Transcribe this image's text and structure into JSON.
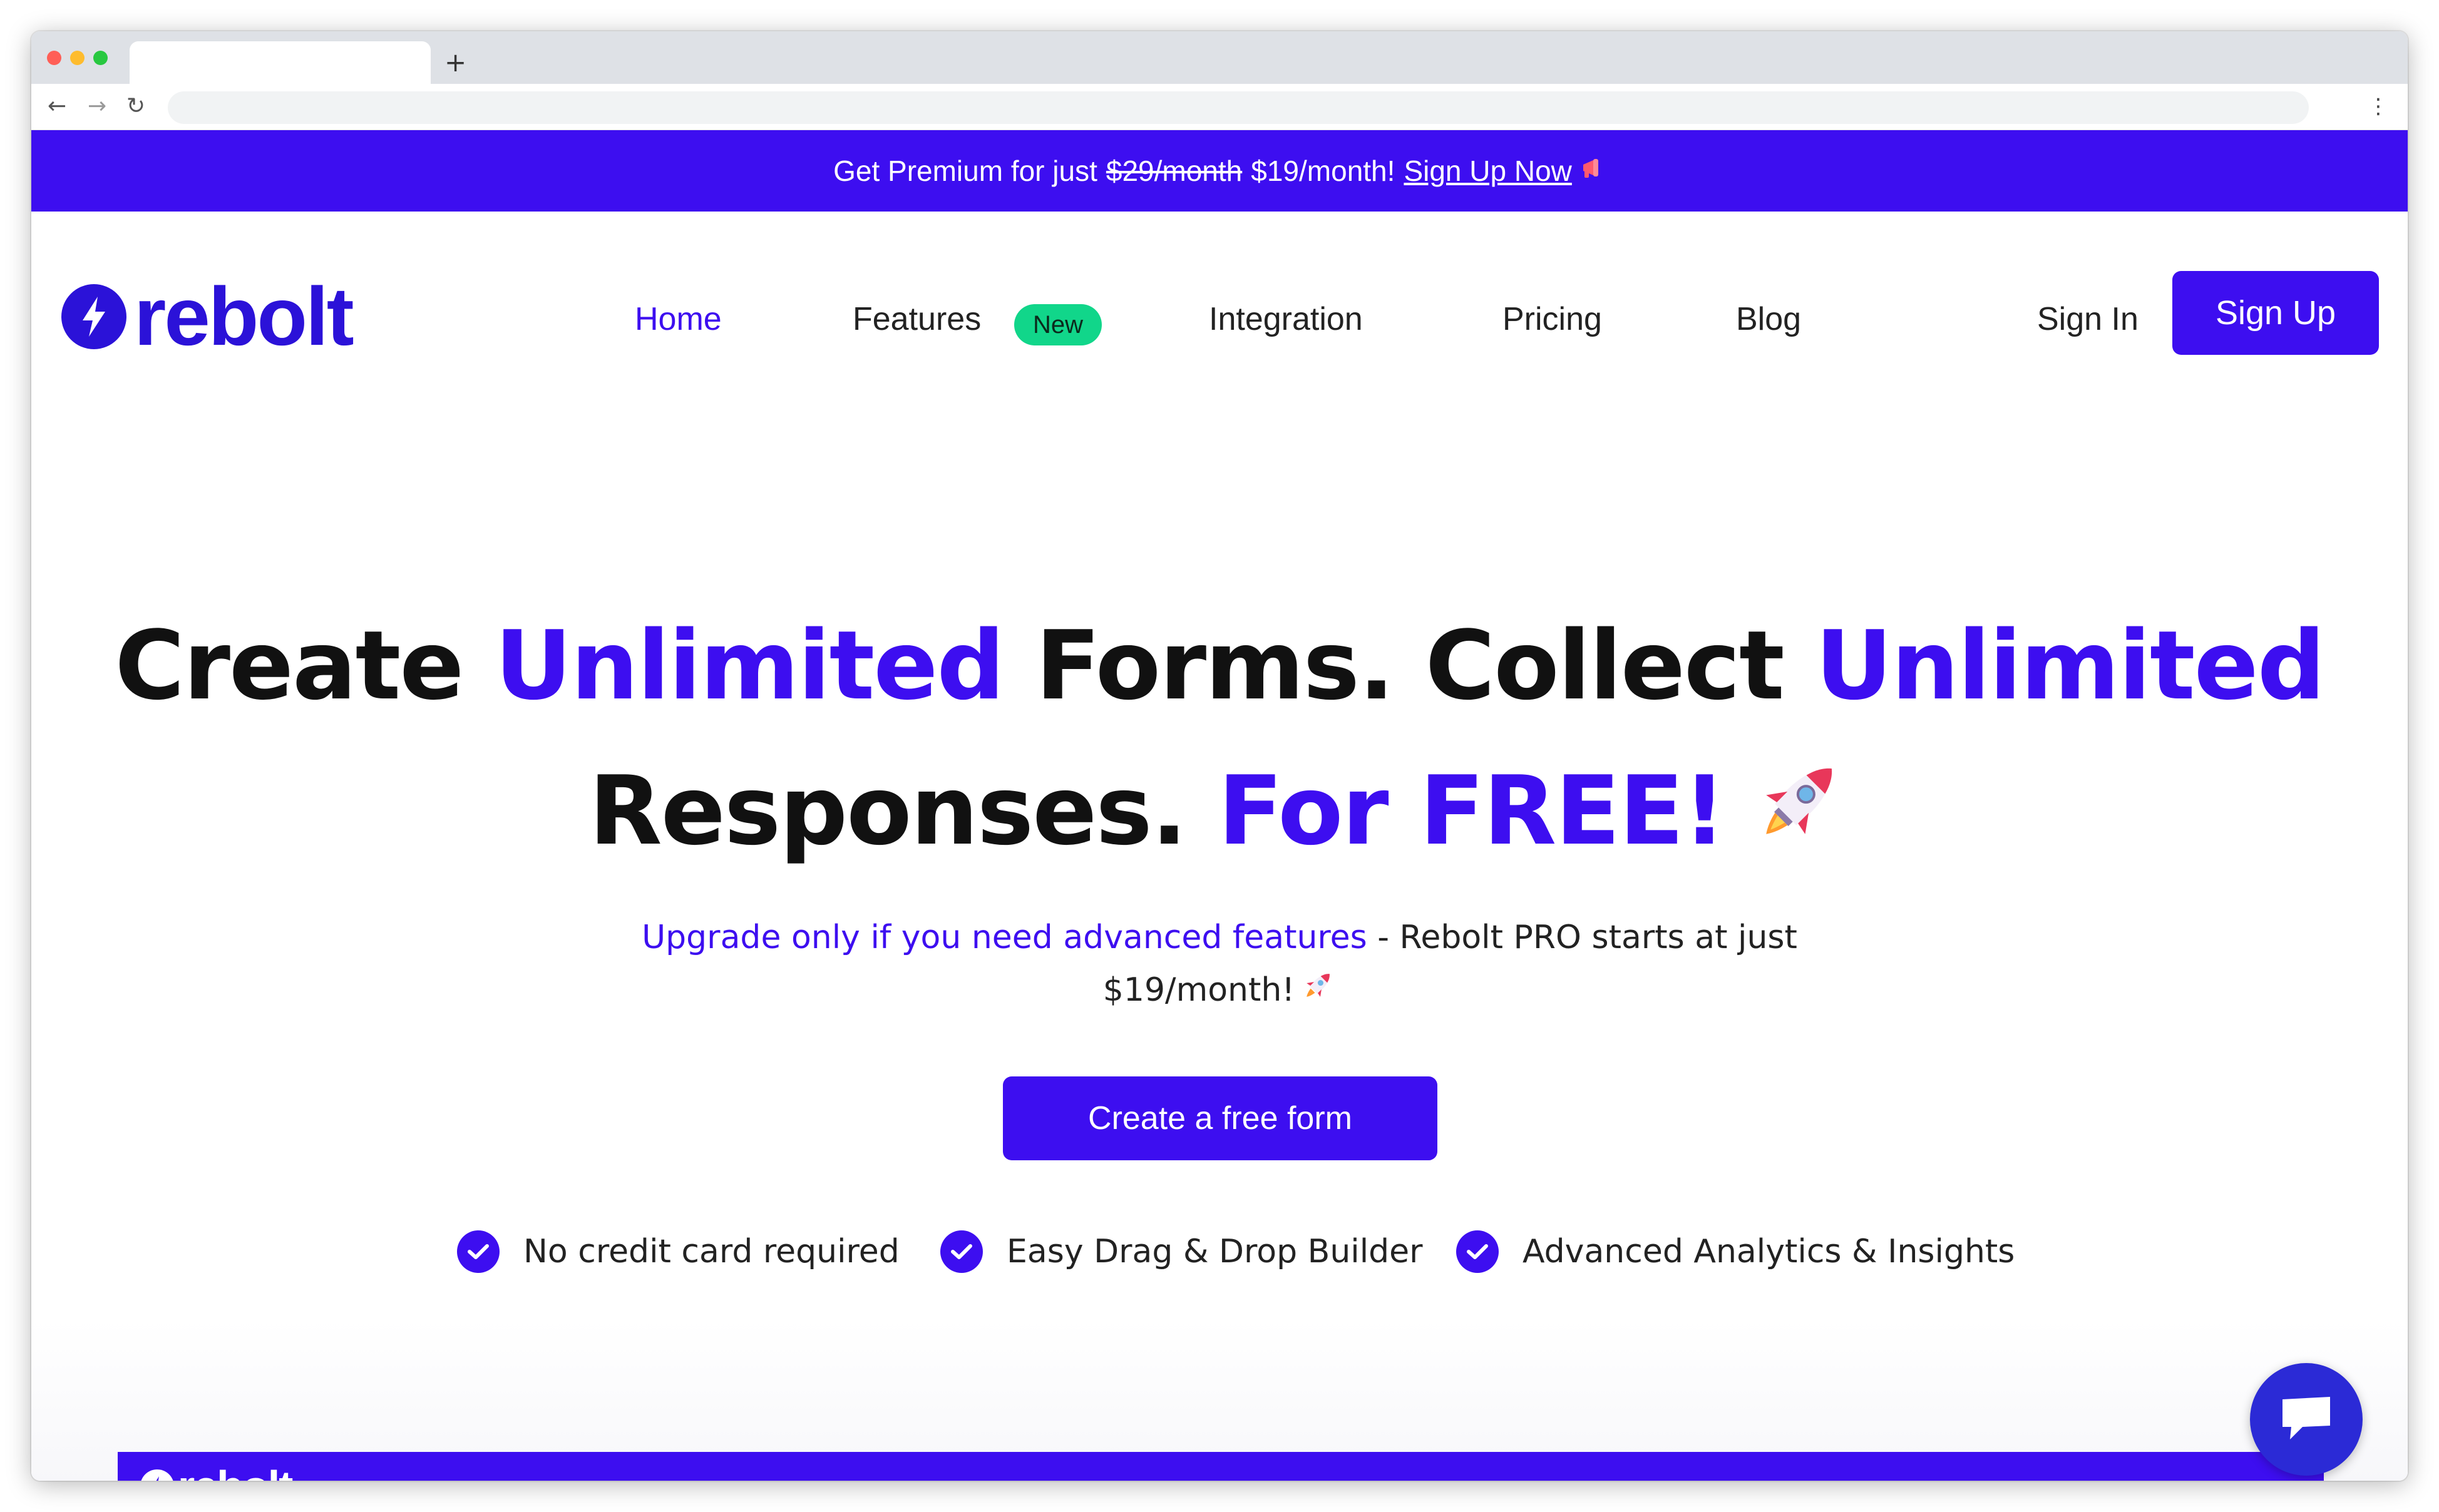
{
  "browser": {
    "new_tab_glyph": "+",
    "back_glyph": "←",
    "forward_glyph": "→",
    "reload_glyph": "↻",
    "menu_glyph": "⋮",
    "address": ""
  },
  "promo": {
    "lead": "Get Premium for just",
    "old_price": "$29/month",
    "new_price": "$19/month!",
    "link": "Sign Up Now",
    "icon": "megaphone-icon"
  },
  "nav": {
    "logo_text": "rebolt",
    "items": [
      {
        "label": "Home",
        "active": true
      },
      {
        "label": "Features"
      },
      {
        "label": "Integration"
      },
      {
        "label": "Pricing"
      },
      {
        "label": "Blog"
      }
    ],
    "features_badge": "New",
    "sign_in": "Sign In",
    "sign_up": "Sign Up"
  },
  "hero": {
    "line1": {
      "a": "Create ",
      "b": "Unlimited",
      "c": " Forms. Collect ",
      "d": "Unlimited"
    },
    "line2": {
      "a": "Responses. ",
      "b": "For FREE!"
    },
    "subtitle_highlight": "Upgrade only if you need advanced features",
    "subtitle_rest": " - Rebolt PRO starts at just",
    "subtitle_line2": "$19/month!",
    "cta": "Create a free form",
    "perks": [
      "No credit card required",
      "Easy Drag & Drop Builder",
      "Advanced Analytics & Insights"
    ]
  },
  "preview": {
    "logo_text": "rebolt"
  },
  "colors": {
    "brand": "#3d0ef0",
    "badge_green": "#11d68a",
    "chat": "#2b2ad6"
  }
}
